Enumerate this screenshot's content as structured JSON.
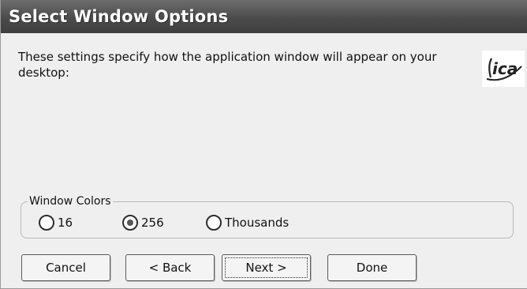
{
  "dialog": {
    "title": "Select Window Options",
    "description": "These settings specify how the application window will appear on your desktop:",
    "logo_text": "ica"
  },
  "window_colors": {
    "legend": "Window Colors",
    "options": [
      {
        "label": "16",
        "selected": false
      },
      {
        "label": "256",
        "selected": true
      },
      {
        "label": "Thousands",
        "selected": false
      }
    ]
  },
  "buttons": {
    "cancel": "Cancel",
    "back": "< Back",
    "next": "Next >",
    "done": "Done"
  }
}
